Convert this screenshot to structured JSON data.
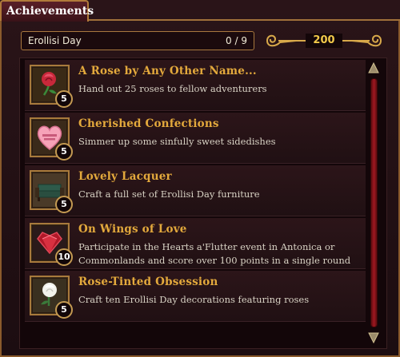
{
  "window": {
    "tab_label": "Achievements"
  },
  "header": {
    "event_name": "Erollisi Day",
    "progress": "0 / 9",
    "points": "200"
  },
  "achievements": [
    {
      "title": "A Rose by Any Other Name...",
      "description": "Hand out 25 roses to fellow adventurers",
      "points": "5",
      "icon": "red-rose-icon"
    },
    {
      "title": "Cherished Confections",
      "description": "Simmer up some sinfully sweet sidedishes",
      "points": "5",
      "icon": "candy-heart-icon"
    },
    {
      "title": "Lovely Lacquer",
      "description": "Craft a full set of Erollisi Day furniture",
      "points": "5",
      "icon": "couch-icon"
    },
    {
      "title": "On Wings of Love",
      "description": "Participate in the Hearts a'Flutter event in Antonica or Commonlands and score over 100 points in a single round",
      "points": "10",
      "icon": "ruby-heart-icon"
    },
    {
      "title": "Rose-Tinted Obsession",
      "description": "Craft ten Erollisi Day decorations featuring roses",
      "points": "5",
      "icon": "white-rose-icon"
    }
  ],
  "colors": {
    "title_gold": "#e3a93c",
    "frame_gold": "#a87a3c",
    "scroll_red": "#a01820",
    "background": "#1c0d11"
  }
}
